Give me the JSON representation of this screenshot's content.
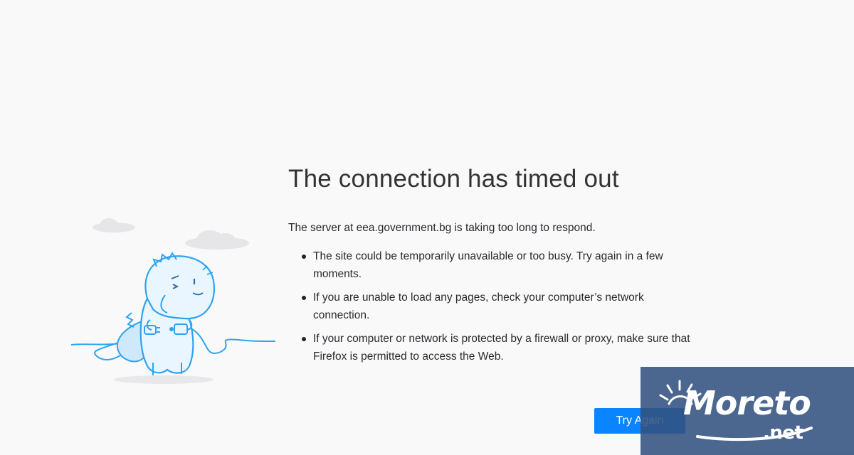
{
  "error": {
    "title": "The connection has timed out",
    "description": "The server at eea.government.bg is taking too long to respond.",
    "bullets": [
      "The site could be temporarily unavailable or too busy. Try again in a few moments.",
      "If you are unable to load any pages, check your computer’s network connection.",
      "If your computer or network is protected by a firewall or proxy, make sure that Firefox is permitted to access the Web."
    ],
    "try_again_label": "Try Again"
  },
  "illustration": {
    "icon": "unplugged-dinosaur-icon",
    "colors": {
      "outline": "#2ea3f2",
      "fill": "#eaf6ff",
      "cloud": "#e6e6e8"
    }
  },
  "watermark": {
    "text": "Moreto",
    "suffix": ".net",
    "background": "#325280"
  },
  "colors": {
    "background": "#f9f9fa",
    "accent": "#0a84ff",
    "text": "#2a2a2e"
  }
}
